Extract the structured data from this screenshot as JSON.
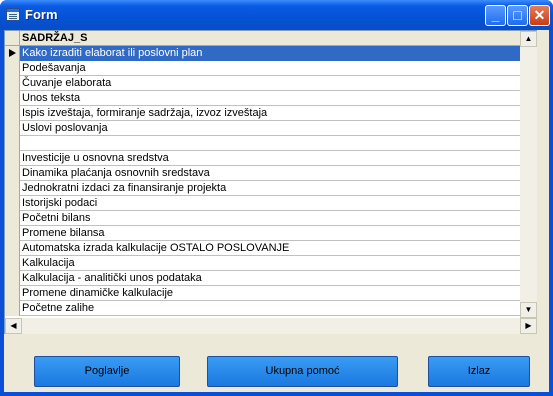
{
  "window": {
    "title": "Form",
    "icon": "form-icon"
  },
  "title_buttons": {
    "minimize_label": "_",
    "maximize_label": "□",
    "close_label": "✕"
  },
  "grid": {
    "column_header": "SADRŽAJ_S",
    "current_row_index": 0,
    "rows": [
      "Kako izraditi elaborat ili poslovni plan",
      "Podešavanja",
      "Čuvanje elaborata",
      "Unos teksta",
      "Ispis izveštaja, formiranje sadržaja, izvoz izveštaja",
      "Uslovi poslovanja",
      "",
      "Investicije u osnovna sredstva",
      "Dinamika plaćanja osnovnih sredstava",
      "Jednokratni izdaci za finansiranje projekta",
      "Istorijski podaci",
      "Početni bilans",
      "Promene bilansa",
      "Automatska izrada kalkulacije OSTALO POSLOVANJE",
      "Kalkulacija",
      "Kalkulacija - analitički unos podataka",
      "Promene dinamičke  kalkulacije",
      "Početne zalihe"
    ]
  },
  "scrollbars": {
    "up": "▲",
    "down": "▼",
    "left": "◀",
    "right": "▶"
  },
  "buttons": {
    "chapter": "Poglavlje",
    "total_help": "Ukupna pomoć",
    "exit": "Izlaz"
  },
  "colors": {
    "title_bar": "#0a5ae4",
    "selection": "#316ac5",
    "button": "#2a8aec",
    "client": "#ece9d8"
  }
}
